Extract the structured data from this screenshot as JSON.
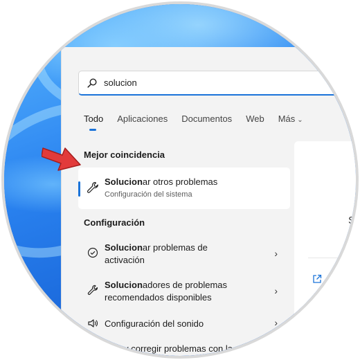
{
  "search": {
    "value": "solucion"
  },
  "tabs": [
    {
      "label": "Todo"
    },
    {
      "label": "Aplicaciones"
    },
    {
      "label": "Documentos"
    },
    {
      "label": "Web"
    },
    {
      "label": "Más"
    }
  ],
  "best_match": {
    "heading": "Mejor coincidencia",
    "title_bold": "Solucion",
    "title_rest": "ar otros problemas",
    "subtitle": "Configuración del sistema"
  },
  "settings": {
    "heading": "Configuración",
    "items": [
      {
        "bold": "Solucion",
        "rest": "ar problemas de",
        "line2": "activación",
        "icon": "check-circle-icon"
      },
      {
        "bold": "Solucion",
        "rest": "adores de problemas",
        "line2": "recomendados disponibles",
        "icon": "wrench-icon"
      },
      {
        "bold": "",
        "rest": "Configuración del sonido",
        "line2": "",
        "icon": "speaker-icon"
      },
      {
        "bold": "",
        "rest": "…ar y corregir problemas con la",
        "line2": "",
        "icon": ""
      }
    ]
  },
  "preview": {
    "letter": "S"
  },
  "colors": {
    "accent": "#1a73d9",
    "arrow": "#e23b3b"
  }
}
